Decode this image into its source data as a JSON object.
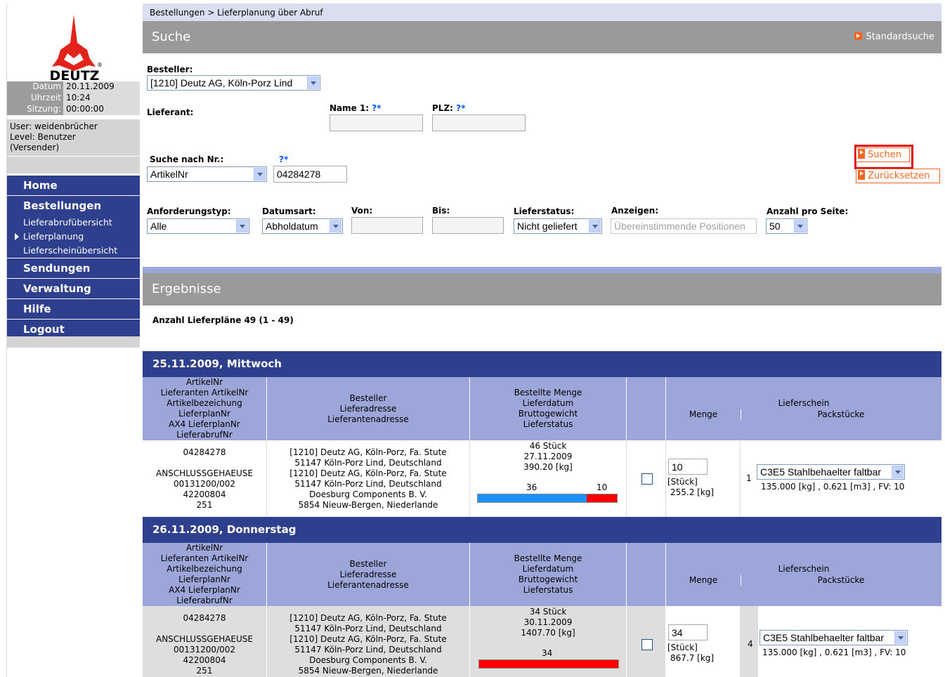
{
  "breadcrumb": "Bestellungen > Lieferplanung über Abruf",
  "sidebar": {
    "logo_text": "DEUTZ",
    "info": [
      {
        "label": "Datum",
        "value": "20.11.2009"
      },
      {
        "label": "Uhrzeit",
        "value": "10:24"
      },
      {
        "label": "Sitzung:",
        "value": "00:00:00"
      }
    ],
    "user": "User: weidenbrücher",
    "level": "Level:  Benutzer",
    "level2": "(Versender)",
    "nav": {
      "home": "Home",
      "bestellungen": "Bestellungen",
      "sub1": "Lieferabrufübersicht",
      "sub2": "Lieferplanung",
      "sub3": "Lieferscheinübersicht",
      "sendungen": "Sendungen",
      "verwaltung": "Verwaltung",
      "hilfe": "Hilfe",
      "logout": "Logout"
    }
  },
  "search": {
    "title": "Suche",
    "standard_link": "Standardsuche",
    "besteller_label": "Besteller:",
    "besteller_value": "[1210] Deutz AG, Köln-Porz Lind",
    "lieferant_label": "Lieferant:",
    "name1_label": "Name 1:",
    "plz_label": "PLZ:",
    "q": "?*",
    "suche_nr_label": "Suche nach Nr.:",
    "suche_nr_type": "ArtikelNr",
    "suche_nr_value": "04284278",
    "suchen": "Suchen",
    "zuruecksetzen": "Zurücksetzen",
    "anforderungstyp_label": "Anforderungstyp:",
    "anforderungstyp_value": "Alle",
    "datumsart_label": "Datumsart:",
    "datumsart_value": "Abholdatum",
    "von_label": "Von:",
    "bis_label": "Bis:",
    "lieferstatus_label": "Lieferstatus:",
    "lieferstatus_value": "Nicht geliefert",
    "anzeigen_label": "Anzeigen:",
    "anzeigen_value": "Übereinstimmende Positionen",
    "anzahl_label": "Anzahl pro Seite:",
    "anzahl_value": "50"
  },
  "results": {
    "title": "Ergebnisse",
    "count_text": "Anzahl Lieferpläne 49 (1 - 49)",
    "headers": {
      "col1": [
        "ArtikelNr",
        "Lieferanten ArtikelNr",
        "Artikelbezeichung",
        "LieferplanNr",
        "AX4 LieferplanNr",
        "LieferabrufNr"
      ],
      "col2": [
        "Besteller",
        "Lieferadresse",
        "Lieferantenadresse"
      ],
      "col3": [
        "Bestellte Menge",
        "Lieferdatum",
        "Bruttogewicht",
        "Lieferstatus"
      ],
      "lieferschein": "Lieferschein",
      "menge": "Menge",
      "packstuecke": "Packstücke"
    },
    "groups": [
      {
        "date": "25.11.2009, Mittwoch",
        "artikel": "04284278",
        "bez": "ANSCHLUSSGEHAEUSE",
        "plan": "00131200/002",
        "ax4": "42200804",
        "abruf": "251",
        "addr": [
          "[1210] Deutz AG,  Köln-Porz, Fa. Stute",
          "51147 Köln-Porz Lind,  Deutschland",
          "[1210] Deutz AG,  Köln-Porz, Fa. Stute",
          "51147 Köln-Porz Lind,  Deutschland",
          "Doesburg Components B. V.",
          "5854 Nieuw-Bergen,  Niederlande"
        ],
        "menge": "46 Stück",
        "lieferdatum": "27.11.2009",
        "gewicht": "390.20 [kg]",
        "bar_blue_label": "36",
        "bar_red_label": "10",
        "bar_blue": 36,
        "bar_red": 10,
        "ls_menge": "10",
        "ls_unit": "[Stück]",
        "ls_weight": "255.2 [kg]",
        "pack_count": "1",
        "pack_type": "C3E5 Stahlbehaelter faltbar",
        "pack_info": "135.000 [kg] ,  0.621 [m3] , FV: 10"
      },
      {
        "date": "26.11.2009, Donnerstag",
        "artikel": "04284278",
        "bez": "ANSCHLUSSGEHAEUSE",
        "plan": "00131200/002",
        "ax4": "42200804",
        "abruf": "251",
        "addr": [
          "[1210] Deutz AG,  Köln-Porz, Fa. Stute",
          "51147 Köln-Porz Lind,  Deutschland",
          "[1210] Deutz AG,  Köln-Porz, Fa. Stute",
          "51147 Köln-Porz Lind,  Deutschland",
          "Doesburg Components B. V.",
          "5854 Nieuw-Bergen,  Niederlande"
        ],
        "menge": "34 Stück",
        "lieferdatum": "30.11.2009",
        "gewicht": "1407.70 [kg]",
        "bar_red_label": "34",
        "bar_blue": 0,
        "bar_red": 34,
        "ls_menge": "34",
        "ls_unit": "[Stück]",
        "ls_weight": "867.7 [kg]",
        "pack_count": "4",
        "pack_type": "C3E5 Stahlbehaelter faltbar",
        "pack_info": "135.000 [kg] ,  0.621 [m3] , FV: 10"
      }
    ]
  },
  "colors": {
    "nav_blue": "#2e3f8e",
    "accent_orange": "#f26522",
    "bar_blue": "#1e90ff",
    "bar_red": "#ff0000",
    "header_lavender": "#9da6d8"
  }
}
